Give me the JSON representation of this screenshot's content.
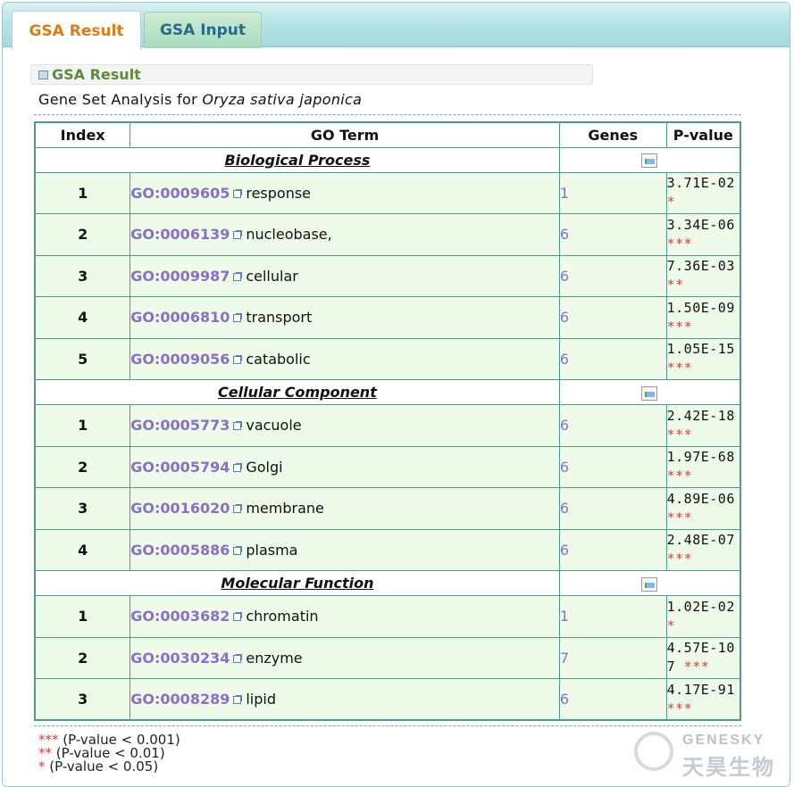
{
  "tabs": [
    {
      "label": "GSA Result",
      "active": true
    },
    {
      "label": "GSA Input",
      "active": false
    }
  ],
  "section": {
    "title": "GSA Result"
  },
  "analysis": {
    "prefix": "Gene Set Analysis for ",
    "organism": "Oryza sativa japonica"
  },
  "table": {
    "headers": {
      "index": "Index",
      "go_term": "GO Term",
      "genes": "Genes",
      "pvalue": "P-value"
    },
    "categories": [
      {
        "name": "Biological Process",
        "rows": [
          {
            "index": "1",
            "go_id": "GO:0009605",
            "term": "response",
            "genes": "1",
            "pvalue": "3.71E-02",
            "stars": "*"
          },
          {
            "index": "2",
            "go_id": "GO:0006139",
            "term": "nucleobase,",
            "genes": "6",
            "pvalue": "3.34E-06",
            "stars": "***"
          },
          {
            "index": "3",
            "go_id": "GO:0009987",
            "term": "cellular",
            "genes": "6",
            "pvalue": "7.36E-03",
            "stars": "**"
          },
          {
            "index": "4",
            "go_id": "GO:0006810",
            "term": "transport",
            "genes": "6",
            "pvalue": "1.50E-09",
            "stars": "***"
          },
          {
            "index": "5",
            "go_id": "GO:0009056",
            "term": "catabolic",
            "genes": "6",
            "pvalue": "1.05E-15",
            "stars": "***"
          }
        ]
      },
      {
        "name": "Cellular Component",
        "rows": [
          {
            "index": "1",
            "go_id": "GO:0005773",
            "term": "vacuole",
            "genes": "6",
            "pvalue": "2.42E-18",
            "stars": "***"
          },
          {
            "index": "2",
            "go_id": "GO:0005794",
            "term": "Golgi",
            "genes": "6",
            "pvalue": "1.97E-68",
            "stars": "***"
          },
          {
            "index": "3",
            "go_id": "GO:0016020",
            "term": "membrane",
            "genes": "6",
            "pvalue": "4.89E-06",
            "stars": "***"
          },
          {
            "index": "4",
            "go_id": "GO:0005886",
            "term": "plasma",
            "genes": "6",
            "pvalue": "2.48E-07",
            "stars": "***"
          }
        ]
      },
      {
        "name": "Molecular Function",
        "rows": [
          {
            "index": "1",
            "go_id": "GO:0003682",
            "term": "chromatin",
            "genes": "1",
            "pvalue": "1.02E-02",
            "stars": "*"
          },
          {
            "index": "2",
            "go_id": "GO:0030234",
            "term": "enzyme",
            "genes": "7",
            "pvalue": "4.57E-107",
            "stars": "***"
          },
          {
            "index": "3",
            "go_id": "GO:0008289",
            "term": "lipid",
            "genes": "6",
            "pvalue": "4.17E-91",
            "stars": "***"
          }
        ]
      }
    ]
  },
  "legend": [
    {
      "stars": "***",
      "text": " (P-value < 0.001)"
    },
    {
      "stars": "**",
      "text": " (P-value < 0.01)"
    },
    {
      "stars": "*",
      "text": " (P-value < 0.05)"
    }
  ],
  "logo": {
    "brand_en": "GENESKY",
    "brand_cn": "天昊生物"
  },
  "colors": {
    "accent_tab": "#e07b14",
    "go_link": "#8a6fc9",
    "stars": "#e23a3a",
    "row_bg": "#eefbe8",
    "border": "#4d9a8e"
  }
}
